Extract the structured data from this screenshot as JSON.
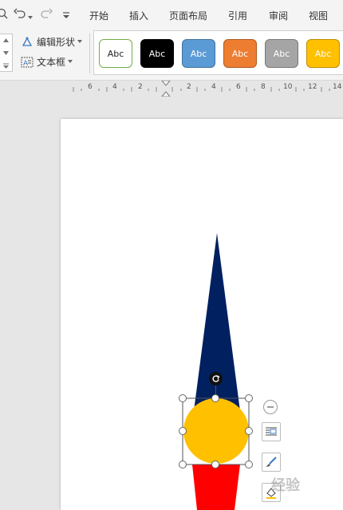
{
  "menubar": {
    "items": [
      "开始",
      "插入",
      "页面布局",
      "引用",
      "审阅",
      "视图"
    ]
  },
  "ribbon": {
    "edit_shape_label": "编辑形状",
    "textbox_label": "文本框",
    "styles": [
      {
        "label": "Abc",
        "bg": "#ffffff",
        "border": "#70ad47",
        "fg": "#222222"
      },
      {
        "label": "Abc",
        "bg": "#000000",
        "border": "#000000",
        "fg": "#ffffff"
      },
      {
        "label": "Abc",
        "bg": "#5b9bd5",
        "border": "#41719c",
        "fg": "#ffffff"
      },
      {
        "label": "Abc",
        "bg": "#ed7d31",
        "border": "#ae5a21",
        "fg": "#ffffff"
      },
      {
        "label": "Abc",
        "bg": "#a5a5a5",
        "border": "#787878",
        "fg": "#ffffff"
      },
      {
        "label": "Abc",
        "bg": "#ffc000",
        "border": "#bc8c00",
        "fg": "#ffffff"
      }
    ]
  },
  "ruler": {
    "labels": [
      "6",
      "4",
      "2",
      "2",
      "4",
      "6",
      "8",
      "10",
      "12",
      "14"
    ]
  },
  "drawing": {
    "top_shape_color": "#002060",
    "circle_color": "#ffc000",
    "bottom_shape_color": "#ff0000"
  },
  "icons": {
    "undo": "undo-icon",
    "redo": "redo-icon",
    "rotate": "rotate-icon",
    "layout": "layout-options-icon",
    "brush": "brush-icon",
    "minus": "collapse-icon"
  },
  "watermark": "经验"
}
